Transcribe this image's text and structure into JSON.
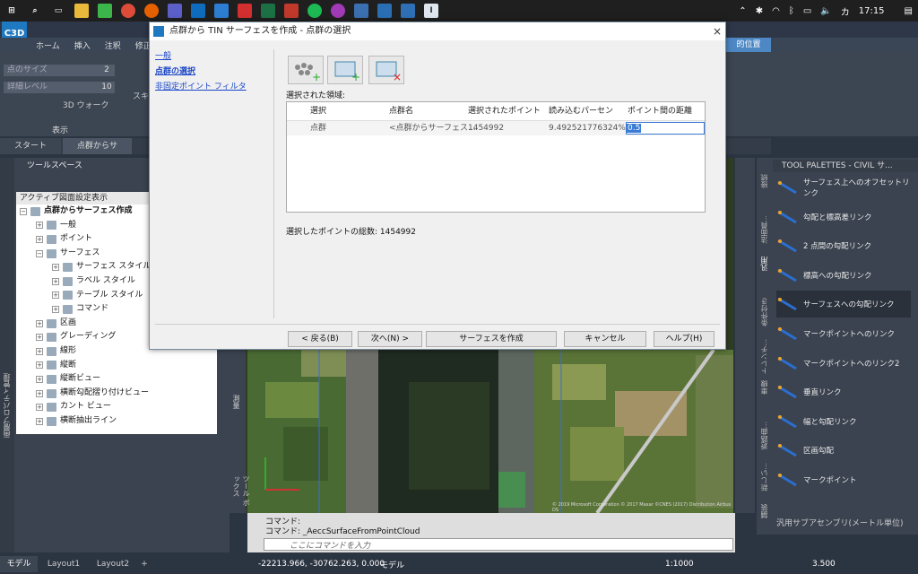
{
  "taskbar": {
    "clock": "17:15",
    "ime": "カ"
  },
  "acad": {
    "logo": "C3D",
    "ribbon_tabs": [
      "ホーム",
      "挿入",
      "注釈",
      "修正"
    ],
    "ribbon_right_label": "的位置",
    "rows": [
      {
        "label": "点のサイズ",
        "value": "2"
      },
      {
        "label": "詳細レベル",
        "value": "10"
      }
    ],
    "walk": "3D ウォーク",
    "sketch": "スキ",
    "panel_label": "表示"
  },
  "doc_tabs": [
    "スタート",
    "点群からサ"
  ],
  "toolspace": {
    "title": "ツールスペース",
    "side_label": "画層プロパティ管理",
    "tree_header": "アクティブ図面設定表示",
    "items": [
      {
        "label": "点群からサーフェス作成",
        "level": 0,
        "bold": true
      },
      {
        "label": "一般",
        "level": 1
      },
      {
        "label": "ポイント",
        "level": 1
      },
      {
        "label": "サーフェス",
        "level": 1
      },
      {
        "label": "サーフェス スタイル",
        "level": 2
      },
      {
        "label": "ラベル スタイル",
        "level": 2
      },
      {
        "label": "テーブル スタイル",
        "level": 2
      },
      {
        "label": "コマンド",
        "level": 2
      },
      {
        "label": "区画",
        "level": 1
      },
      {
        "label": "グレーディング",
        "level": 1
      },
      {
        "label": "線形",
        "level": 1
      },
      {
        "label": "縦断",
        "level": 1
      },
      {
        "label": "縦断ビュー",
        "level": 1
      },
      {
        "label": "横断勾配摺り付けビュー",
        "level": 1
      },
      {
        "label": "カント ビュー",
        "level": 1
      },
      {
        "label": "横断抽出ライン",
        "level": 1
      }
    ]
  },
  "viewport": {
    "side_labels": [
      "測量",
      "ツール ボックス"
    ],
    "copyright": "© 2019 Microsoft Corporation © 2017 Maxar ©CNES (2017) Distribution Airbus DS"
  },
  "palette": {
    "title": "TOOL PALETTES - CIVIL サ...",
    "tabs": [
      "接続",
      "法面員...",
      "汎用",
      "条件付き",
      "トレンチ...",
      "車線",
      "遊路曲...",
      "新しい...",
      "舗装"
    ],
    "items": [
      "サーフェス上へのオフセットリンク",
      "勾配と標高差リンク",
      "2 点間の勾配リンク",
      "標高への勾配リンク",
      "サーフェスへの勾配リンク",
      "マークポイントへのリンク",
      "マークポイントへのリンク2",
      "垂直リンク",
      "幅と勾配リンク",
      "区画勾配",
      "マークポイント"
    ],
    "footer": "汎用サブアセンブリ(メートル単位)"
  },
  "command": {
    "line1": "コマンド:",
    "line2": "コマンド:  _AeccSurfaceFromPointCloud",
    "placeholder": "ここにコマンドを入力"
  },
  "status": {
    "tabs": [
      "モデル",
      "Layout1",
      "Layout2"
    ],
    "coords": "-22213.966, -30762.263, 0.000",
    "model": "モデル",
    "scale": "1:1000",
    "zoom": "3.500"
  },
  "dialog": {
    "title": "点群から TIN サーフェスを作成 - 点群の選択",
    "nav": [
      "一般",
      "点群の選択",
      "非固定ポイント フィルタ"
    ],
    "selected_label": "選択された領域:",
    "columns": [
      "選択",
      "点群名",
      "選択されたポイント",
      "読み込むパーセンテ...",
      "ポイント間の距離"
    ],
    "row": [
      "点群",
      "<点群からサーフェス...",
      "1454992",
      "9.492521776324%",
      "0.5"
    ],
    "total": "選択したポイントの総数: 1454992",
    "buttons": [
      "< 戻る(B)",
      "次へ(N) >",
      "サーフェスを作成",
      "キャンセル",
      "ヘルプ(H)"
    ]
  }
}
